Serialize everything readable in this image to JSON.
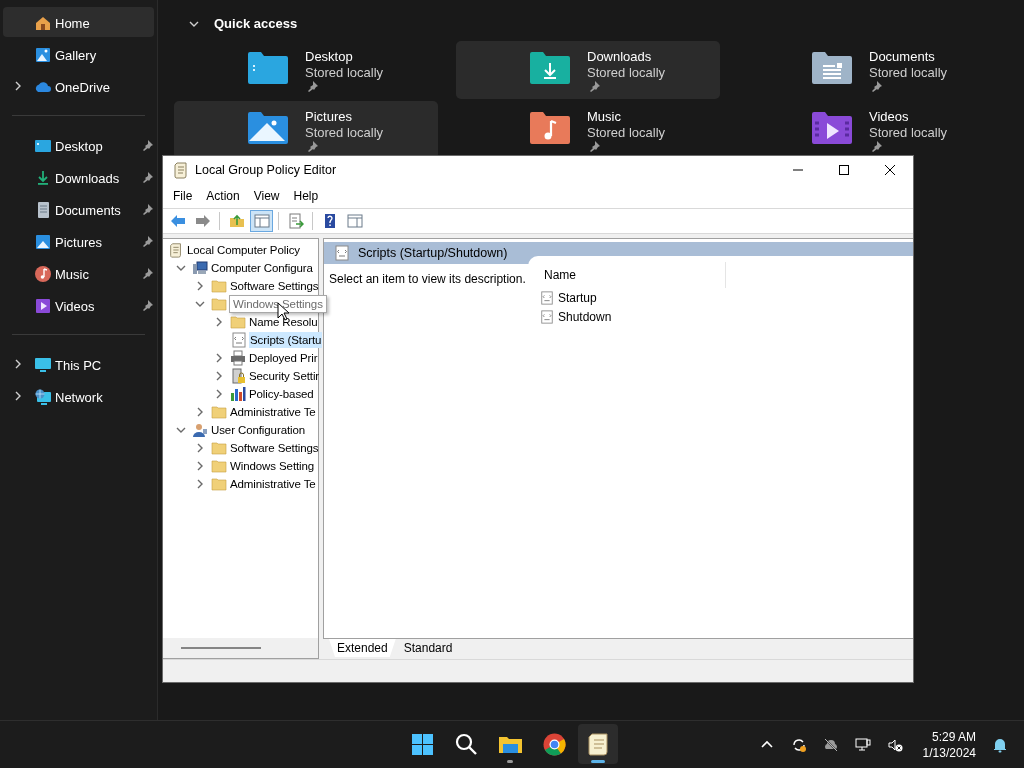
{
  "explorer": {
    "sidebar": {
      "groups": [
        {
          "items": [
            {
              "label": "Home",
              "kind": "home",
              "selected": true,
              "expandable": false,
              "pinned": false
            },
            {
              "label": "Gallery",
              "kind": "gallery",
              "selected": false,
              "expandable": false,
              "pinned": false
            },
            {
              "label": "OneDrive",
              "kind": "cloud",
              "selected": false,
              "expandable": true,
              "pinned": false
            }
          ]
        },
        {
          "items": [
            {
              "label": "Desktop",
              "kind": "desktop",
              "selected": false,
              "expandable": false,
              "pinned": true
            },
            {
              "label": "Downloads",
              "kind": "downloads",
              "selected": false,
              "expandable": false,
              "pinned": true
            },
            {
              "label": "Documents",
              "kind": "documents",
              "selected": false,
              "expandable": false,
              "pinned": true
            },
            {
              "label": "Pictures",
              "kind": "pictures",
              "selected": false,
              "expandable": false,
              "pinned": true
            },
            {
              "label": "Music",
              "kind": "music",
              "selected": false,
              "expandable": false,
              "pinned": true
            },
            {
              "label": "Videos",
              "kind": "videos",
              "selected": false,
              "expandable": false,
              "pinned": true
            }
          ]
        },
        {
          "items": [
            {
              "label": "This PC",
              "kind": "pc",
              "selected": false,
              "expandable": true,
              "pinned": false
            },
            {
              "label": "Network",
              "kind": "network",
              "selected": false,
              "expandable": true,
              "pinned": false
            }
          ]
        }
      ]
    },
    "quick_access": {
      "title": "Quick access",
      "expanded": true,
      "tiles": [
        {
          "name": "Desktop",
          "subtitle": "Stored locally",
          "kind": "desktop",
          "pinned": true,
          "highlighted": false
        },
        {
          "name": "Downloads",
          "subtitle": "Stored locally",
          "kind": "downloads",
          "pinned": true,
          "highlighted": true
        },
        {
          "name": "Documents",
          "subtitle": "Stored locally",
          "kind": "documents",
          "pinned": true,
          "highlighted": false
        },
        {
          "name": "Pictures",
          "subtitle": "Stored locally",
          "kind": "pictures",
          "pinned": true,
          "highlighted": true
        },
        {
          "name": "Music",
          "subtitle": "Stored locally",
          "kind": "music",
          "pinned": true,
          "highlighted": false
        },
        {
          "name": "Videos",
          "subtitle": "Stored locally",
          "kind": "videos",
          "pinned": true,
          "highlighted": false
        }
      ]
    }
  },
  "editor": {
    "title": "Local Group Policy Editor",
    "menu": [
      "File",
      "Action",
      "View",
      "Help"
    ],
    "toolbar": [
      {
        "kind": "back",
        "pressed": false
      },
      {
        "kind": "forward",
        "pressed": false
      },
      {
        "kind": "separator"
      },
      {
        "kind": "up",
        "pressed": false
      },
      {
        "kind": "tree",
        "pressed": true
      },
      {
        "kind": "separator"
      },
      {
        "kind": "export",
        "pressed": false
      },
      {
        "kind": "separator"
      },
      {
        "kind": "help",
        "pressed": false
      },
      {
        "kind": "properties",
        "pressed": false
      }
    ],
    "tree": [
      {
        "label": "Local Computer Policy",
        "kind": "policy",
        "expandable": false,
        "selected": false,
        "children": [
          {
            "label": "Computer Configura",
            "kind": "computer",
            "expandable": true,
            "expanded": true,
            "selected": false,
            "children": [
              {
                "label": "Software Settings",
                "kind": "folder",
                "expandable": true,
                "expanded": false,
                "selected": false
              },
              {
                "label": "Windows Settings",
                "kind": "folder",
                "expandable": true,
                "expanded": true,
                "selected": false,
                "tooltip": true,
                "children": [
                  {
                    "label": "Name Resolu",
                    "kind": "folder",
                    "expandable": true,
                    "expanded": false,
                    "selected": false
                  },
                  {
                    "label": "Scripts (Startu",
                    "kind": "script",
                    "expandable": false,
                    "selected": true
                  },
                  {
                    "label": "Deployed Prir",
                    "kind": "printer",
                    "expandable": true,
                    "expanded": false,
                    "selected": false
                  },
                  {
                    "label": "Security Settir",
                    "kind": "security",
                    "expandable": true,
                    "expanded": false,
                    "selected": false
                  },
                  {
                    "label": "Policy-based",
                    "kind": "chart",
                    "expandable": true,
                    "expanded": false,
                    "selected": false
                  }
                ]
              },
              {
                "label": "Administrative Te",
                "kind": "folder",
                "expandable": true,
                "expanded": false,
                "selected": false
              }
            ]
          },
          {
            "label": "User Configuration",
            "kind": "user",
            "expandable": true,
            "expanded": true,
            "selected": false,
            "children": [
              {
                "label": "Software Settings",
                "kind": "folder",
                "expandable": true,
                "expanded": false,
                "selected": false
              },
              {
                "label": "Windows Setting",
                "kind": "folder",
                "expandable": true,
                "expanded": false,
                "selected": false
              },
              {
                "label": "Administrative Te",
                "kind": "folder",
                "expandable": true,
                "expanded": false,
                "selected": false
              }
            ]
          }
        ]
      }
    ],
    "detail": {
      "header": "Scripts (Startup/Shutdown)",
      "description": "Select an item to view its description.",
      "column": "Name",
      "items": [
        "Startup",
        "Shutdown"
      ]
    },
    "tabs": [
      {
        "label": "Extended",
        "selected": true
      },
      {
        "label": "Standard",
        "selected": false
      }
    ]
  },
  "taskbar": {
    "apps": [
      {
        "kind": "start",
        "running": false,
        "active": false
      },
      {
        "kind": "search",
        "running": false,
        "active": false
      },
      {
        "kind": "explorer",
        "running": true,
        "active": false
      },
      {
        "kind": "chrome",
        "running": false,
        "active": false
      },
      {
        "kind": "scroll",
        "running": true,
        "active": true
      }
    ],
    "time": "5:29 AM",
    "date": "1/13/2024"
  }
}
